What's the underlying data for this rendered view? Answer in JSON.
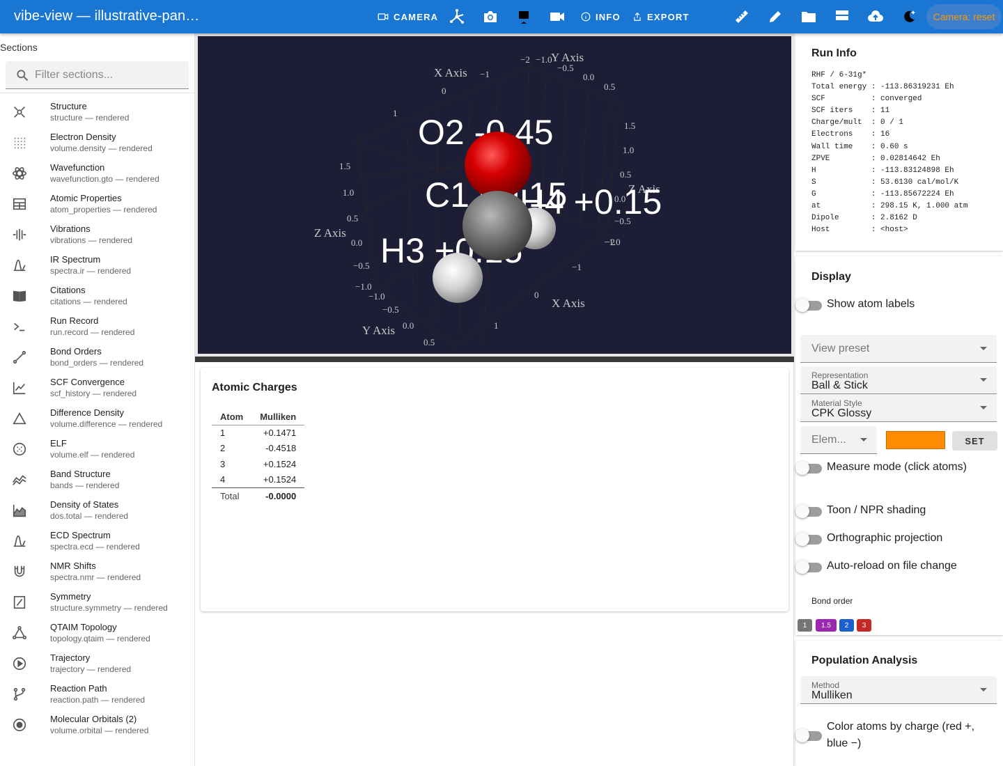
{
  "app": {
    "title": "vibe-view — illustrative-pan…"
  },
  "toolbar": {
    "camera_label": "CAMERA",
    "info_label": "INFO",
    "export_label": "EXPORT",
    "camera_chip": "Camera: reset",
    "icons": [
      "camera-icon",
      "structure-icon",
      "screenshot-icon",
      "presentation-icon",
      "video-icon",
      "info-icon",
      "export-icon",
      "text-icon",
      "ruler-icon",
      "pencil-icon",
      "folder-icon",
      "server-icon",
      "cloud-upload-icon",
      "theme-icon"
    ]
  },
  "sidebar": {
    "title": "Sections",
    "filter_placeholder": "Filter sections...",
    "items": [
      {
        "name": "Structure",
        "sub": "structure — rendered",
        "icon": "structure-icon"
      },
      {
        "name": "Electron Density",
        "sub": "volume.density — rendered",
        "icon": "dots-grid-icon"
      },
      {
        "name": "Wavefunction",
        "sub": "wavefunction.gto — rendered",
        "icon": "atom-icon"
      },
      {
        "name": "Atomic Properties",
        "sub": "atom_properties — rendered",
        "icon": "table-icon"
      },
      {
        "name": "Vibrations",
        "sub": "vibrations — rendered",
        "icon": "vibration-icon"
      },
      {
        "name": "IR Spectrum",
        "sub": "spectra.ir — rendered",
        "icon": "spectrum-icon"
      },
      {
        "name": "Citations",
        "sub": "citations — rendered",
        "icon": "book-icon"
      },
      {
        "name": "Run Record",
        "sub": "run.record — rendered",
        "icon": "terminal-icon"
      },
      {
        "name": "Bond Orders",
        "sub": "bond_orders — rendered",
        "icon": "bond-icon"
      },
      {
        "name": "SCF Convergence",
        "sub": "scf_history — rendered",
        "icon": "line-chart-icon"
      },
      {
        "name": "Difference Density",
        "sub": "volume.difference — rendered",
        "icon": "triangle-icon"
      },
      {
        "name": "ELF",
        "sub": "volume.elf — rendered",
        "icon": "dotted-circle-icon"
      },
      {
        "name": "Band Structure",
        "sub": "bands — rendered",
        "icon": "bands-icon"
      },
      {
        "name": "Density of States",
        "sub": "dos.total — rendered",
        "icon": "area-chart-icon"
      },
      {
        "name": "ECD Spectrum",
        "sub": "spectra.ecd — rendered",
        "icon": "spectrum-icon"
      },
      {
        "name": "NMR Shifts",
        "sub": "spectra.nmr — rendered",
        "icon": "magnet-icon"
      },
      {
        "name": "Symmetry",
        "sub": "structure.symmetry — rendered",
        "icon": "symmetry-icon"
      },
      {
        "name": "QTAIM Topology",
        "sub": "topology.qtaim — rendered",
        "icon": "topology-icon"
      },
      {
        "name": "Trajectory",
        "sub": "trajectory — rendered",
        "icon": "play-circle-icon"
      },
      {
        "name": "Reaction Path",
        "sub": "reaction.path — rendered",
        "icon": "branch-icon"
      },
      {
        "name": "Molecular Orbitals (2)",
        "sub": "volume.orbital — rendered",
        "icon": "orbital-icon"
      }
    ]
  },
  "viewer": {
    "axis_labels": {
      "x": "X Axis",
      "y": "Y Axis",
      "z": "Z Axis"
    },
    "atom_labels": [
      "O2 -0.45",
      "C1 +0.15",
      "H4 +0.15",
      "H3 +0.15"
    ],
    "colors": {
      "background": "#1d1d35",
      "oxygen": "#d40000",
      "carbon": "#777777",
      "hydrogen": "#d8d8d8"
    }
  },
  "charges": {
    "title": "Atomic Charges",
    "headers": [
      "Atom",
      "Mulliken"
    ],
    "rows": [
      {
        "atom": "1",
        "value": "+0.1471"
      },
      {
        "atom": "2",
        "value": "-0.4518"
      },
      {
        "atom": "3",
        "value": "+0.1524"
      },
      {
        "atom": "4",
        "value": "+0.1524"
      }
    ],
    "total_label": "Total",
    "total_value": "-0.0000"
  },
  "run_info": {
    "title": "Run Info",
    "text": "RHF / 6-31g*\nTotal energy : -113.86319231 Eh\nSCF          : converged\nSCF iters    : 11\nCharge/mult  : 0 / 1\nElectrons    : 16\nWall time    : 0.60 s\nZPVE         : 0.02814642 Eh\nH            : -113.83124898 Eh\nS            : 53.6130 cal/mol/K\nG            : -113.85672224 Eh\nat           : 298.15 K, 1.000 atm\nDipole       : 2.8162 D\nHost         : <host>"
  },
  "display": {
    "title": "Display",
    "show_atom_labels": "Show atom labels",
    "view_preset": "View preset",
    "representation_label": "Representation",
    "representation_value": "Ball & Stick",
    "material_label": "Material Style",
    "material_value": "CPK Glossy",
    "element_placeholder": "Elem...",
    "element_color": "#ff8c00",
    "set_label": "SET",
    "measure_mode": "Measure mode (click atoms)",
    "toon": "Toon / NPR shading",
    "ortho": "Orthographic projection",
    "autoreload": "Auto-reload on file change",
    "bond_order_label": "Bond order",
    "bond_orders": [
      {
        "label": "1",
        "color": "#757575"
      },
      {
        "label": "1.5",
        "color": "#9c27b0"
      },
      {
        "label": "2",
        "color": "#1e5fd0"
      },
      {
        "label": "3",
        "color": "#c62828"
      }
    ]
  },
  "population": {
    "title": "Population Analysis",
    "method_label": "Method",
    "method_value": "Mulliken",
    "color_by_charge": "Color atoms by charge (red +, blue −)"
  }
}
